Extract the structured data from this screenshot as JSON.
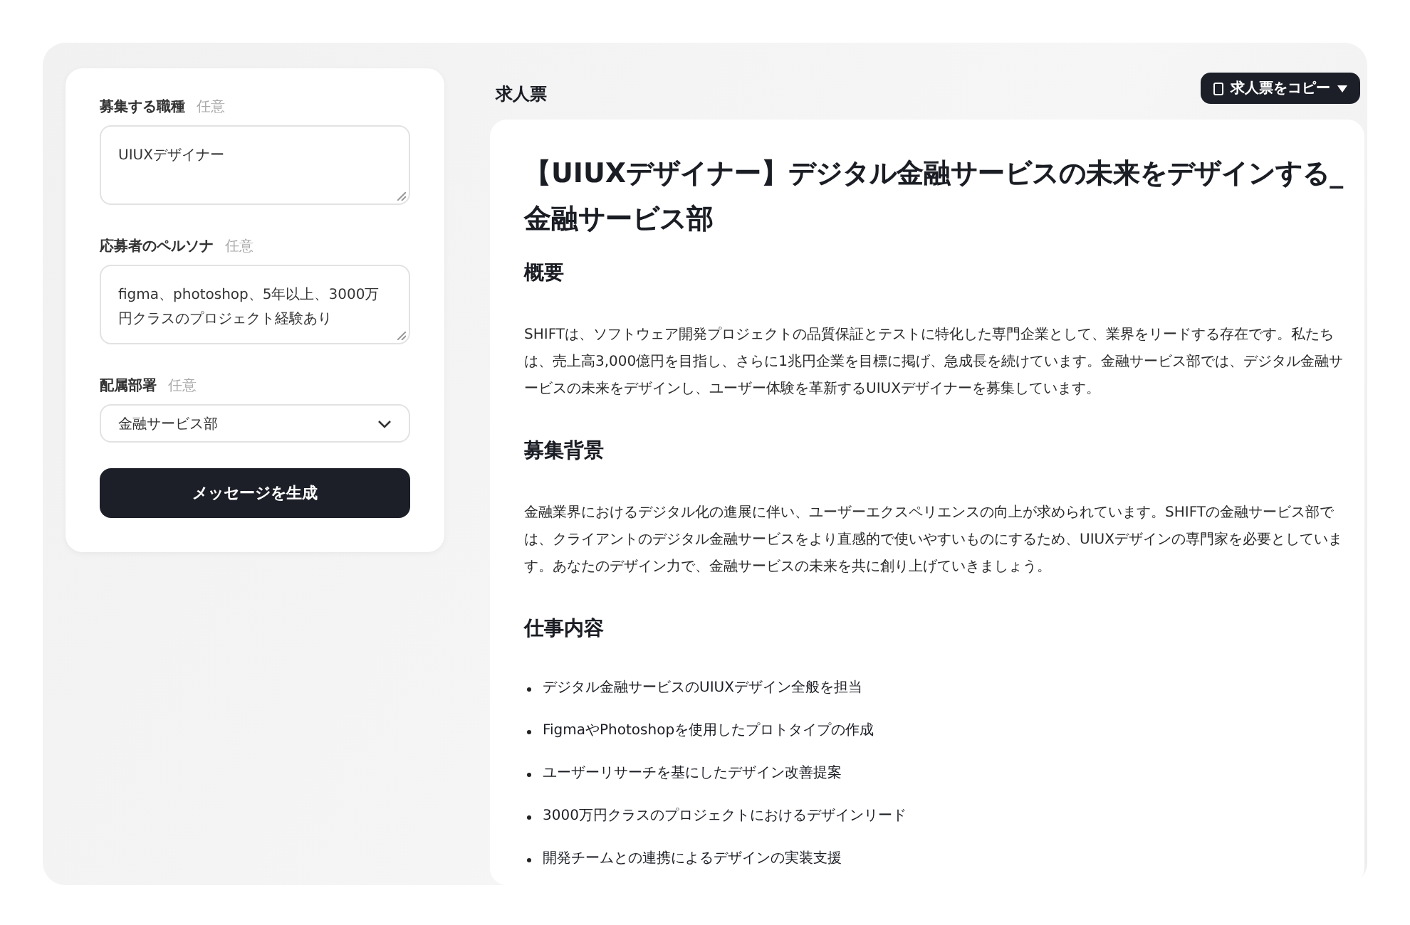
{
  "form": {
    "fields": [
      {
        "kind": "textarea",
        "label": "募集する職種",
        "badge": "任意",
        "value": "UIUXデザイナー"
      },
      {
        "kind": "textarea",
        "label": "応募者のペルソナ",
        "badge": "任意",
        "value": "figma、photoshop、5年以上、3000万円クラスのプロジェクト経験あり"
      },
      {
        "kind": "select",
        "label": "配属部署",
        "badge": "任意",
        "value": "金融サービス部"
      }
    ],
    "submit_button": "メッセージを生成"
  },
  "document": {
    "header": "求人票",
    "copy_button": "求人票をコピー",
    "title": "【UIUXデザイナー】デジタル金融サービスの未来をデザインする_金融サービス部",
    "sections": [
      {
        "kind": "paragraph",
        "heading": "概要",
        "text": "SHIFTは、ソフトウェア開発プロジェクトの品質保証とテストに特化した専門企業として、業界をリードする存在です。私たちは、売上高3,000億円を目指し、さらに1兆円企業を目標に掲げ、急成長を続けています。金融サービス部では、デジタル金融サービスの未来をデザインし、ユーザー体験を革新するUIUXデザイナーを募集しています。"
      },
      {
        "kind": "paragraph",
        "heading": "募集背景",
        "text": "金融業界におけるデジタル化の進展に伴い、ユーザーエクスペリエンスの向上が求められています。SHIFTの金融サービス部では、クライアントのデジタル金融サービスをより直感的で使いやすいものにするため、UIUXデザインの専門家を必要としています。あなたのデザイン力で、金融サービスの未来を共に創り上げていきましょう。"
      },
      {
        "kind": "list",
        "heading": "仕事内容",
        "items": [
          "デジタル金融サービスのUIUXデザイン全般を担当",
          "FigmaやPhotoshopを使用したプロトタイプの作成",
          "ユーザーリサーチを基にしたデザイン改善提案",
          "3000万円クラスのプロジェクトにおけるデザインリード",
          "開発チームとの連携によるデザインの実装支援"
        ]
      }
    ]
  }
}
